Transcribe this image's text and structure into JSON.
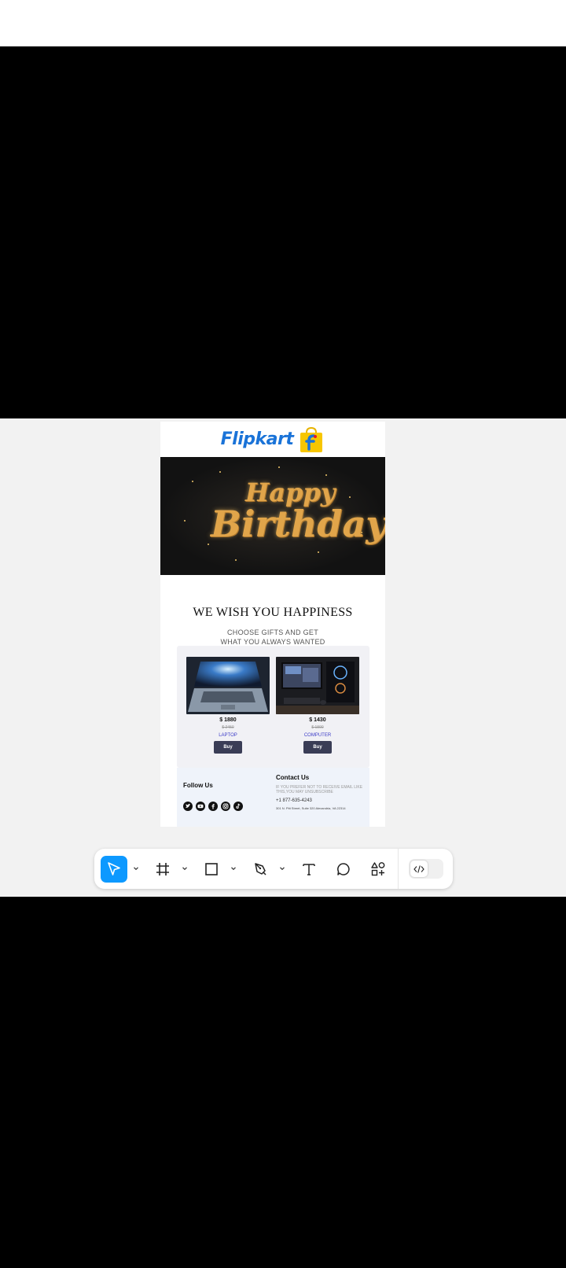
{
  "email": {
    "brand": "Flipkart",
    "hero_line1": "Happy",
    "hero_line2": "Birthday",
    "heading": "WE WISH YOU HAPPINESS",
    "subheading_line1": "CHOOSE GIFTS AND GET",
    "subheading_line2": "WHAT YOU ALWAYS WANTED",
    "products": [
      {
        "price": "$ 1880",
        "old_price": "$ 2450",
        "name": "LAPTOP",
        "button": "Buy"
      },
      {
        "price": "$ 1430",
        "old_price": "$ 1890",
        "name": "COMPUTER",
        "button": "Buy"
      }
    ],
    "footer": {
      "follow_title": "Follow Us",
      "contact_title": "Contact Us",
      "unsubscribe": "IF YOU PREFER NOT TO RECEIVE EMAIL LIKE THIS,YOU MAY UNSUBSCRIBE",
      "phone": "+1 877-635-4243",
      "address": "301 N. Pitt Street, Suite 320 Alexandria, VA 22314"
    },
    "socials": [
      "twitter-icon",
      "youtube-icon",
      "facebook-icon",
      "instagram-icon",
      "tiktok-icon"
    ]
  },
  "toolbar": {
    "tools": [
      "move-tool",
      "frame-tool",
      "shape-tool",
      "pen-tool",
      "text-tool",
      "comment-tool",
      "actions-tool"
    ],
    "active_tool": "move-tool",
    "dev_mode": "off"
  },
  "colors": {
    "accent": "#0d99ff",
    "brand_blue": "#1a73d8",
    "brand_yellow": "#f7c600",
    "buy_button": "#3a3d56",
    "product_name": "#3c3cc8"
  }
}
